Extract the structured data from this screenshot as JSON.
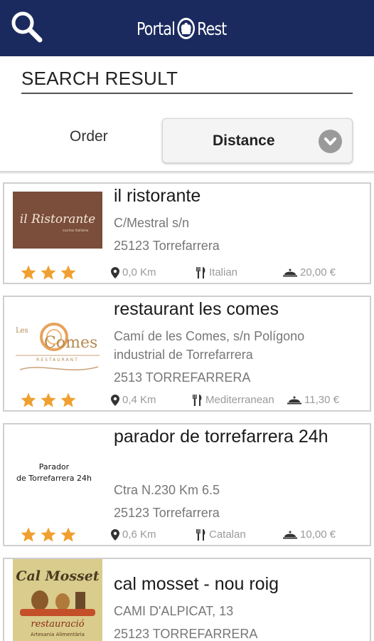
{
  "header": {
    "logo_left": "Portal",
    "logo_right": "Rest"
  },
  "page_title": "SEARCH RESULT",
  "order": {
    "label": "Order",
    "value": "Distance"
  },
  "results": [
    {
      "name": "il ristorante",
      "lines": [
        "C/Mestral s/n",
        "25123 Torrefarrera"
      ],
      "rating": 3,
      "distance": "0,0 Km",
      "cuisine": "Italian",
      "price": "20,00 €",
      "logo": {
        "text": "il Ristorante",
        "subtext": "cucina italiana",
        "bg": "#7a4e3b"
      }
    },
    {
      "name": "restaurant les comes",
      "lines": [
        "Camí de les Comes, s/n Polígono",
        "industrial de Torrefarrera",
        "2513 TORREFARRERA"
      ],
      "rating": 3,
      "distance": "0,4 Km",
      "cuisine": "Mediterranean",
      "price": "11,30 €",
      "logo": {
        "text_small": "Les",
        "text_main": "Comes",
        "subtext": "RESTAURANT"
      }
    },
    {
      "name": "parador de torrefarrera 24h",
      "lines": [
        "Ctra N.230 Km 6.5",
        "25123 Torrefarrera"
      ],
      "rating": 3,
      "distance": "0,6 Km",
      "cuisine": "Catalan",
      "price": "10,00 €",
      "logo": {
        "line1": "Parador",
        "line2": "de Torrefarrera 24h"
      }
    },
    {
      "name": "cal mosset - nou roig",
      "lines": [
        "CAMI D'ALPICAT, 13",
        "25123 TORREFARRERA"
      ],
      "logo": {
        "text": "Cal Mosset",
        "subtext": "restauració",
        "subtext2": "Artesania Alimentària"
      }
    }
  ],
  "colors": {
    "header_bg": "#1b2a5e",
    "star": "#f0a030",
    "card_border": "#cfcfcf"
  }
}
